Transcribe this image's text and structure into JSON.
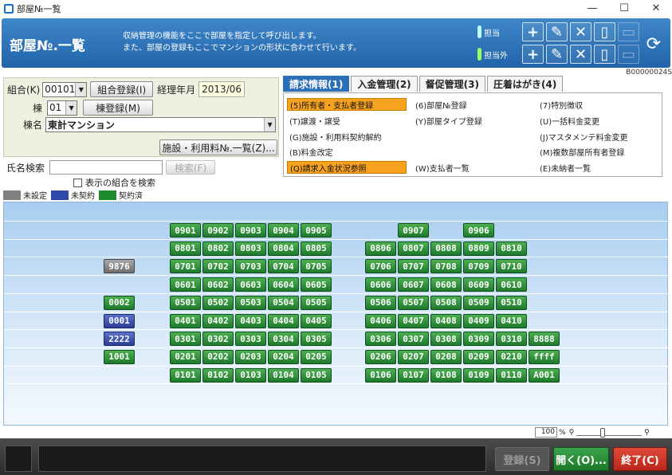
{
  "window": {
    "title": "部屋№一覧",
    "min": "—",
    "max": "☐",
    "close": "✕"
  },
  "header": {
    "title": "部屋№.一覧",
    "desc1": "収納管理の機能をここで部屋を指定して呼び出します。",
    "desc2": "また、部屋の登録もここでマンションの形状に合わせて行います。",
    "role1": "担当",
    "role2": "担当外",
    "record_id": "B00000024S"
  },
  "form": {
    "kumiai_label": "組合(K)",
    "kumiai_value": "00101",
    "kumiai_btn": "組合登録(I)",
    "ym_label": "経理年月",
    "ym_value": "2013/06",
    "to_label": "棟",
    "to_value": "01",
    "to_btn": "棟登録(M)",
    "toname_label": "棟名",
    "toname_value": "東計マンション",
    "facility_btn": "施設・利用料№.一覧(Z)..."
  },
  "search": {
    "label": "氏名検索",
    "value": "",
    "button": "検索(F)",
    "checkbox_label": "表示の組合を検索"
  },
  "legend": [
    {
      "label": "未設定",
      "color": "#808080"
    },
    {
      "label": "未契約",
      "color": "#2f4aa8"
    },
    {
      "label": "契約済",
      "color": "#1f8a2e"
    }
  ],
  "tabs": [
    "請求情報(1)",
    "入金管理(2)",
    "督促管理(3)",
    "圧着はがき(4)"
  ],
  "menu": [
    {
      "label": "(5)所有者・支払者登録",
      "hl": true
    },
    {
      "label": "(6)部屋№登録",
      "hl": false
    },
    {
      "label": "(7)特別徴収",
      "hl": false
    },
    {
      "label": "(T)譲渡・譲受",
      "hl": false
    },
    {
      "label": "(Y)部屋タイプ登録",
      "hl": false
    },
    {
      "label": "(U)一括料金変更",
      "hl": false
    },
    {
      "label": "(G)施設・利用料契約解約",
      "hl": false
    },
    {
      "label": "(J)マスタメンテ料金変更",
      "hl": false
    },
    {
      "label": "(B)料金改定",
      "hl": false
    },
    {
      "label": "(M)複数部屋所有者登録",
      "hl": false
    },
    {
      "label": "(Q)請求入金状況参照",
      "hl": true
    },
    {
      "label": "(W)支払者一覧",
      "hl": false
    },
    {
      "label": "(E)未納者一覧",
      "hl": false
    }
  ],
  "rooms": {
    "floors": [
      {
        "left": [
          "0901",
          "0902",
          "0903",
          "0904",
          "0905"
        ],
        "right": [
          null,
          "0907",
          null,
          "0906",
          null
        ],
        "extra": null,
        "side": null
      },
      {
        "left": [
          "0801",
          "0802",
          "0803",
          "0804",
          "0805"
        ],
        "right": [
          "0806",
          "0807",
          "0808",
          "0809",
          "0810"
        ],
        "extra": null,
        "side": null
      },
      {
        "left": [
          "0701",
          "0702",
          "0703",
          "0704",
          "0705"
        ],
        "right": [
          "0706",
          "0707",
          "0708",
          "0709",
          "0710"
        ],
        "extra": null,
        "side": {
          "label": "9876",
          "status": "unset"
        }
      },
      {
        "left": [
          "0601",
          "0602",
          "0603",
          "0604",
          "0605"
        ],
        "right": [
          "0606",
          "0607",
          "0608",
          "0609",
          "0610"
        ],
        "extra": null,
        "side": null
      },
      {
        "left": [
          "0501",
          "0502",
          "0503",
          "0504",
          "0505"
        ],
        "right": [
          "0506",
          "0507",
          "0508",
          "0509",
          "0510"
        ],
        "extra": null,
        "side": {
          "label": "0002",
          "status": "contracted"
        }
      },
      {
        "left": [
          "0401",
          "0402",
          "0403",
          "0404",
          "0405"
        ],
        "right": [
          "0406",
          "0407",
          "0408",
          "0409",
          "0410"
        ],
        "extra": null,
        "side": {
          "label": "0001",
          "status": "uncontracted"
        }
      },
      {
        "left": [
          "0301",
          "0302",
          "0303",
          "0304",
          "0305"
        ],
        "right": [
          "0306",
          "0307",
          "0308",
          "0309",
          "0310"
        ],
        "extra": "8888",
        "side": {
          "label": "2222",
          "status": "uncontracted"
        }
      },
      {
        "left": [
          "0201",
          "0202",
          "0203",
          "0204",
          "0205"
        ],
        "right": [
          "0206",
          "0207",
          "0208",
          "0209",
          "0210"
        ],
        "extra": "ffff",
        "side": {
          "label": "1001",
          "status": "contracted"
        }
      },
      {
        "left": [
          "0101",
          "0102",
          "0103",
          "0104",
          "0105"
        ],
        "right": [
          "0106",
          "0107",
          "0108",
          "0109",
          "0110"
        ],
        "extra": "A001",
        "side": null
      }
    ]
  },
  "zoom": {
    "value": "100",
    "unit": "%"
  },
  "footer": {
    "register": "登録(S)",
    "open": "開く(O)...",
    "exit": "終了(C)"
  }
}
